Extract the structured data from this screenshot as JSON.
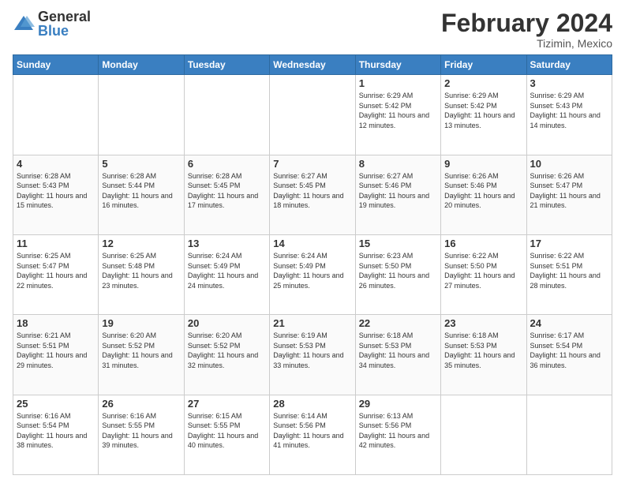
{
  "header": {
    "logo_general": "General",
    "logo_blue": "Blue",
    "title": "February 2024",
    "subtitle": "Tizimin, Mexico"
  },
  "days_of_week": [
    "Sunday",
    "Monday",
    "Tuesday",
    "Wednesday",
    "Thursday",
    "Friday",
    "Saturday"
  ],
  "weeks": [
    [
      {
        "num": "",
        "info": ""
      },
      {
        "num": "",
        "info": ""
      },
      {
        "num": "",
        "info": ""
      },
      {
        "num": "",
        "info": ""
      },
      {
        "num": "1",
        "info": "Sunrise: 6:29 AM\nSunset: 5:42 PM\nDaylight: 11 hours and 12 minutes."
      },
      {
        "num": "2",
        "info": "Sunrise: 6:29 AM\nSunset: 5:42 PM\nDaylight: 11 hours and 13 minutes."
      },
      {
        "num": "3",
        "info": "Sunrise: 6:29 AM\nSunset: 5:43 PM\nDaylight: 11 hours and 14 minutes."
      }
    ],
    [
      {
        "num": "4",
        "info": "Sunrise: 6:28 AM\nSunset: 5:43 PM\nDaylight: 11 hours and 15 minutes."
      },
      {
        "num": "5",
        "info": "Sunrise: 6:28 AM\nSunset: 5:44 PM\nDaylight: 11 hours and 16 minutes."
      },
      {
        "num": "6",
        "info": "Sunrise: 6:28 AM\nSunset: 5:45 PM\nDaylight: 11 hours and 17 minutes."
      },
      {
        "num": "7",
        "info": "Sunrise: 6:27 AM\nSunset: 5:45 PM\nDaylight: 11 hours and 18 minutes."
      },
      {
        "num": "8",
        "info": "Sunrise: 6:27 AM\nSunset: 5:46 PM\nDaylight: 11 hours and 19 minutes."
      },
      {
        "num": "9",
        "info": "Sunrise: 6:26 AM\nSunset: 5:46 PM\nDaylight: 11 hours and 20 minutes."
      },
      {
        "num": "10",
        "info": "Sunrise: 6:26 AM\nSunset: 5:47 PM\nDaylight: 11 hours and 21 minutes."
      }
    ],
    [
      {
        "num": "11",
        "info": "Sunrise: 6:25 AM\nSunset: 5:47 PM\nDaylight: 11 hours and 22 minutes."
      },
      {
        "num": "12",
        "info": "Sunrise: 6:25 AM\nSunset: 5:48 PM\nDaylight: 11 hours and 23 minutes."
      },
      {
        "num": "13",
        "info": "Sunrise: 6:24 AM\nSunset: 5:49 PM\nDaylight: 11 hours and 24 minutes."
      },
      {
        "num": "14",
        "info": "Sunrise: 6:24 AM\nSunset: 5:49 PM\nDaylight: 11 hours and 25 minutes."
      },
      {
        "num": "15",
        "info": "Sunrise: 6:23 AM\nSunset: 5:50 PM\nDaylight: 11 hours and 26 minutes."
      },
      {
        "num": "16",
        "info": "Sunrise: 6:22 AM\nSunset: 5:50 PM\nDaylight: 11 hours and 27 minutes."
      },
      {
        "num": "17",
        "info": "Sunrise: 6:22 AM\nSunset: 5:51 PM\nDaylight: 11 hours and 28 minutes."
      }
    ],
    [
      {
        "num": "18",
        "info": "Sunrise: 6:21 AM\nSunset: 5:51 PM\nDaylight: 11 hours and 29 minutes."
      },
      {
        "num": "19",
        "info": "Sunrise: 6:20 AM\nSunset: 5:52 PM\nDaylight: 11 hours and 31 minutes."
      },
      {
        "num": "20",
        "info": "Sunrise: 6:20 AM\nSunset: 5:52 PM\nDaylight: 11 hours and 32 minutes."
      },
      {
        "num": "21",
        "info": "Sunrise: 6:19 AM\nSunset: 5:53 PM\nDaylight: 11 hours and 33 minutes."
      },
      {
        "num": "22",
        "info": "Sunrise: 6:18 AM\nSunset: 5:53 PM\nDaylight: 11 hours and 34 minutes."
      },
      {
        "num": "23",
        "info": "Sunrise: 6:18 AM\nSunset: 5:53 PM\nDaylight: 11 hours and 35 minutes."
      },
      {
        "num": "24",
        "info": "Sunrise: 6:17 AM\nSunset: 5:54 PM\nDaylight: 11 hours and 36 minutes."
      }
    ],
    [
      {
        "num": "25",
        "info": "Sunrise: 6:16 AM\nSunset: 5:54 PM\nDaylight: 11 hours and 38 minutes."
      },
      {
        "num": "26",
        "info": "Sunrise: 6:16 AM\nSunset: 5:55 PM\nDaylight: 11 hours and 39 minutes."
      },
      {
        "num": "27",
        "info": "Sunrise: 6:15 AM\nSunset: 5:55 PM\nDaylight: 11 hours and 40 minutes."
      },
      {
        "num": "28",
        "info": "Sunrise: 6:14 AM\nSunset: 5:56 PM\nDaylight: 11 hours and 41 minutes."
      },
      {
        "num": "29",
        "info": "Sunrise: 6:13 AM\nSunset: 5:56 PM\nDaylight: 11 hours and 42 minutes."
      },
      {
        "num": "",
        "info": ""
      },
      {
        "num": "",
        "info": ""
      }
    ]
  ]
}
